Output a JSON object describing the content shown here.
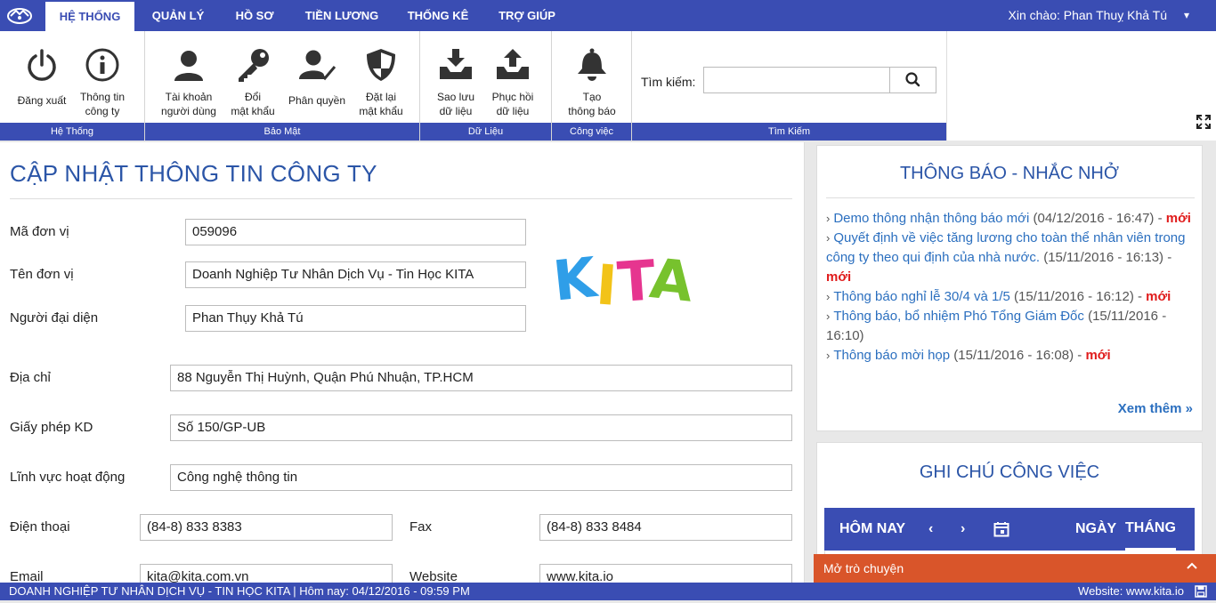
{
  "nav": {
    "tabs": [
      {
        "label": "HỆ THỐNG"
      },
      {
        "label": "QUẢN LÝ"
      },
      {
        "label": "HỒ SƠ"
      },
      {
        "label": "TIỀN LƯƠNG"
      },
      {
        "label": "THỐNG KÊ"
      },
      {
        "label": "TRỢ GIÚP"
      }
    ],
    "active_tab": "HỆ THỐNG",
    "greeting": "Xin chào: Phan Thuỵ Khả Tú"
  },
  "ribbon": {
    "groups": {
      "system": "Hệ Thống",
      "security": "Bảo Mật",
      "data": "Dữ Liệu",
      "work": "Công việc",
      "search": "Tìm Kiếm"
    },
    "buttons": {
      "logout": "Đăng xuất",
      "company_info": "Thông tin\ncông ty",
      "user_account": "Tài khoản\nngười dùng",
      "change_password": "Đổi\nmật khẩu",
      "permissions": "Phân quyền",
      "reset_password": "Đặt lại\nmật khẩu",
      "backup": "Sao lưu\ndữ liệu",
      "restore": "Phục hồi\ndữ liệu",
      "create_notice": "Tạo\nthông báo"
    },
    "search_label": "Tìm kiếm:",
    "search_value": ""
  },
  "form": {
    "title": "CẬP NHẬT THÔNG TIN CÔNG TY",
    "fields": {
      "unit_code": {
        "label": "Mã đơn vị",
        "value": "059096"
      },
      "unit_name": {
        "label": "Tên đơn vị",
        "value": "Doanh Nghiệp Tư Nhân Dịch Vụ - Tin Học KITA"
      },
      "representative": {
        "label": "Người đại diện",
        "value": "Phan Thụy Khả Tú"
      },
      "address": {
        "label": "Địa chỉ",
        "value": "88 Nguyễn Thị Huỳnh, Quận Phú Nhuận, TP.HCM"
      },
      "license": {
        "label": "Giấy phép KD",
        "value": "Số 150/GP-UB"
      },
      "field": {
        "label": "Lĩnh vực hoạt động",
        "value": "Công nghệ thông tin"
      },
      "phone": {
        "label": "Điện thoại",
        "value": "(84-8) 833 8383"
      },
      "fax": {
        "label": "Fax",
        "value": "(84-8) 833 8484"
      },
      "email": {
        "label": "Email",
        "value": "kita@kita.com.vn"
      },
      "website": {
        "label": "Website",
        "value": "www.kita.io"
      }
    },
    "logo_text": "KITA"
  },
  "notices": {
    "title": "THÔNG BÁO - NHẮC NHỞ",
    "items": [
      {
        "text": "Demo thông nhận thông báo mới",
        "date": " (04/12/2016 - 16:47) - ",
        "badge": "mới"
      },
      {
        "text": "Quyết định về việc tăng lương cho toàn thể nhân viên trong công ty theo qui định của nhà nước.",
        "date": " (15/11/2016 - 16:13) - ",
        "badge": "mới"
      },
      {
        "text": "Thông báo nghỉ lễ 30/4 và 1/5",
        "date": " (15/11/2016 - 16:12) - ",
        "badge": "mới"
      },
      {
        "text": "Thông báo, bổ nhiệm Phó Tổng Giám Đốc",
        "date": " (15/11/2016 - 16:10)",
        "badge": ""
      },
      {
        "text": "Thông báo mời họp",
        "date": " (15/11/2016 - 16:08) - ",
        "badge": "mới"
      }
    ],
    "more": "Xem thêm"
  },
  "tasks": {
    "title": "GHI CHÚ CÔNG VIỆC",
    "today": "HÔM NAY",
    "day": "NGÀY",
    "month": "THÁNG"
  },
  "chat": {
    "label": "Mở trò chuyện"
  },
  "footer": {
    "left": "DOANH NGHIỆP TƯ NHÂN DỊCH VỤ - TIN HỌC KITA | Hôm nay: 04/12/2016 - 09:59 PM",
    "right": "Website: www.kita.io"
  },
  "colors": {
    "primary": "#3a4db3",
    "title_blue": "#2b55a7",
    "link_blue": "#2b6fbf",
    "badge_red": "#e01b1b",
    "chat_orange": "#d9552a"
  }
}
